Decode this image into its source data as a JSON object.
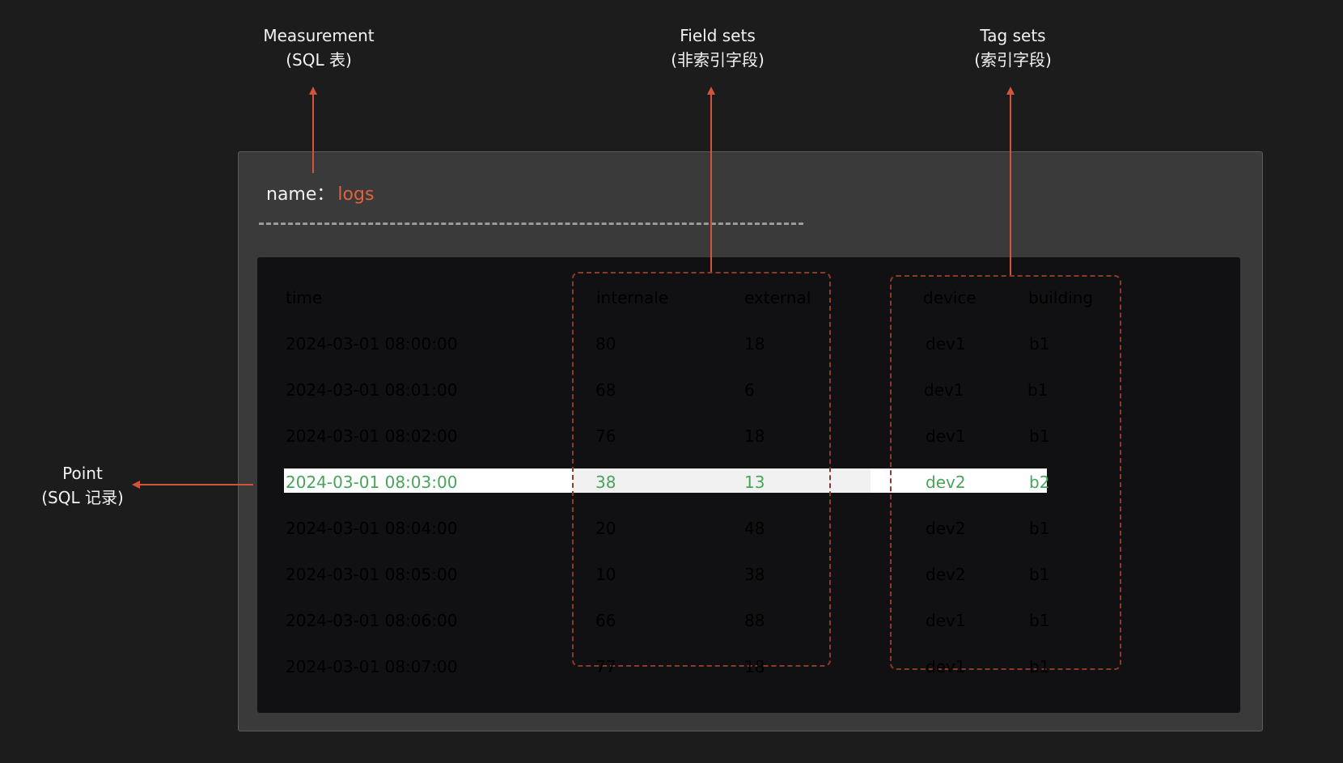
{
  "annotations": {
    "measurement": {
      "line1": "Measurement",
      "line2": "(SQL 表)"
    },
    "field_sets": {
      "line1": "Field sets",
      "line2": "(非索引字段)"
    },
    "tag_sets": {
      "line1": "Tag sets",
      "line2": "(索引字段)"
    },
    "point": {
      "line1": "Point",
      "line2": "(SQL 记录)"
    }
  },
  "measurement": {
    "label": "name：",
    "value": "logs"
  },
  "table": {
    "headers": {
      "time": "time",
      "internale": "internale",
      "external": "external",
      "device": "device",
      "building": "building"
    },
    "rows": [
      {
        "time": "2024-03-01 08:00:00",
        "internale": "80",
        "external": "18",
        "device": "dev1",
        "building": "b1"
      },
      {
        "time": "2024-03-01 08:01:00",
        "internale": "68",
        "external": "6",
        "device": "dev1",
        "building": "b1"
      },
      {
        "time": "2024-03-01 08:02:00",
        "internale": "76",
        "external": "18",
        "device": "dev1",
        "building": "b1"
      },
      {
        "time": "2024-03-01 08:03:00",
        "internale": "38",
        "external": "13",
        "device": "dev2",
        "building": "b2"
      },
      {
        "time": "2024-03-01 08:04:00",
        "internale": "20",
        "external": "48",
        "device": "dev2",
        "building": "b1"
      },
      {
        "time": "2024-03-01 08:05:00",
        "internale": "10",
        "external": "38",
        "device": "dev2",
        "building": "b1"
      },
      {
        "time": "2024-03-01 08:06:00",
        "internale": "66",
        "external": "88",
        "device": "dev1",
        "building": "b1"
      },
      {
        "time": "2024-03-01 08:07:00",
        "internale": "77",
        "external": "18",
        "device": "dev1",
        "building": "b1"
      }
    ],
    "highlighted_row": 3
  },
  "colors": {
    "background": "#1c1c1c",
    "panel": "#3a3a3a",
    "table_bg": "#111113",
    "accent": "#e0623e",
    "arrow": "#d2553b",
    "highlight_text": "#4aa35c",
    "group_border": "#8b3b2a"
  }
}
